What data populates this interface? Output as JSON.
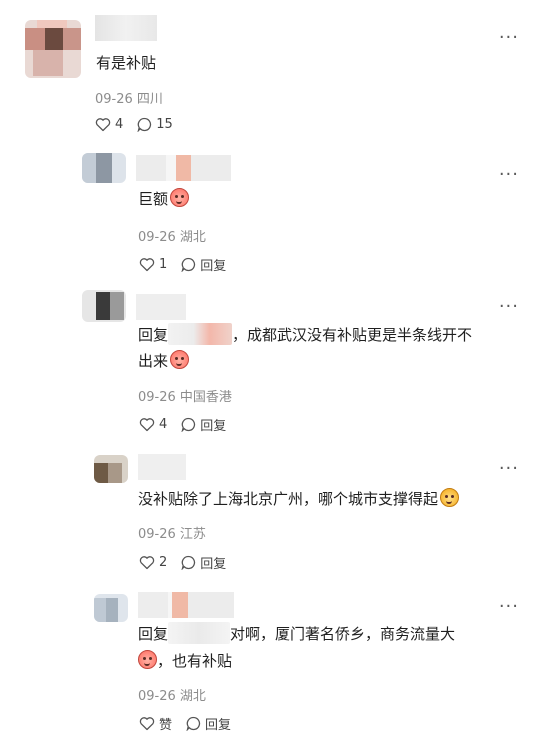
{
  "more_label": "···",
  "comments": [
    {
      "text": "有是补贴",
      "date": "09-26",
      "location": "四川",
      "likes": "4",
      "replies": "15"
    },
    {
      "text": "巨额",
      "date": "09-26",
      "location": "湖北",
      "likes": "1",
      "reply_label": "回复"
    },
    {
      "prefix": "回复",
      "text_line1": "，成都武汉没有补贴更是半条线开不",
      "text_line2": "出来",
      "date": "09-26",
      "location": "中国香港",
      "likes": "4",
      "reply_label": "回复"
    },
    {
      "text": "没补贴除了上海北京广州，哪个城市支撑得起",
      "date": "09-26",
      "location": "江苏",
      "likes": "2",
      "reply_label": "回复"
    },
    {
      "prefix": "回复",
      "text_line1": "对啊，厦门著名侨乡，商务流量大",
      "text_line2": "，也有补贴",
      "date": "09-26",
      "location": "湖北",
      "likes": "赞",
      "reply_label": "回复"
    }
  ],
  "icons": {
    "heart": "heart-outline-icon",
    "comment": "comment-bubble-icon",
    "emoji_red": "blush-face-emoji",
    "emoji_yellow": "cheer-face-emoji"
  }
}
